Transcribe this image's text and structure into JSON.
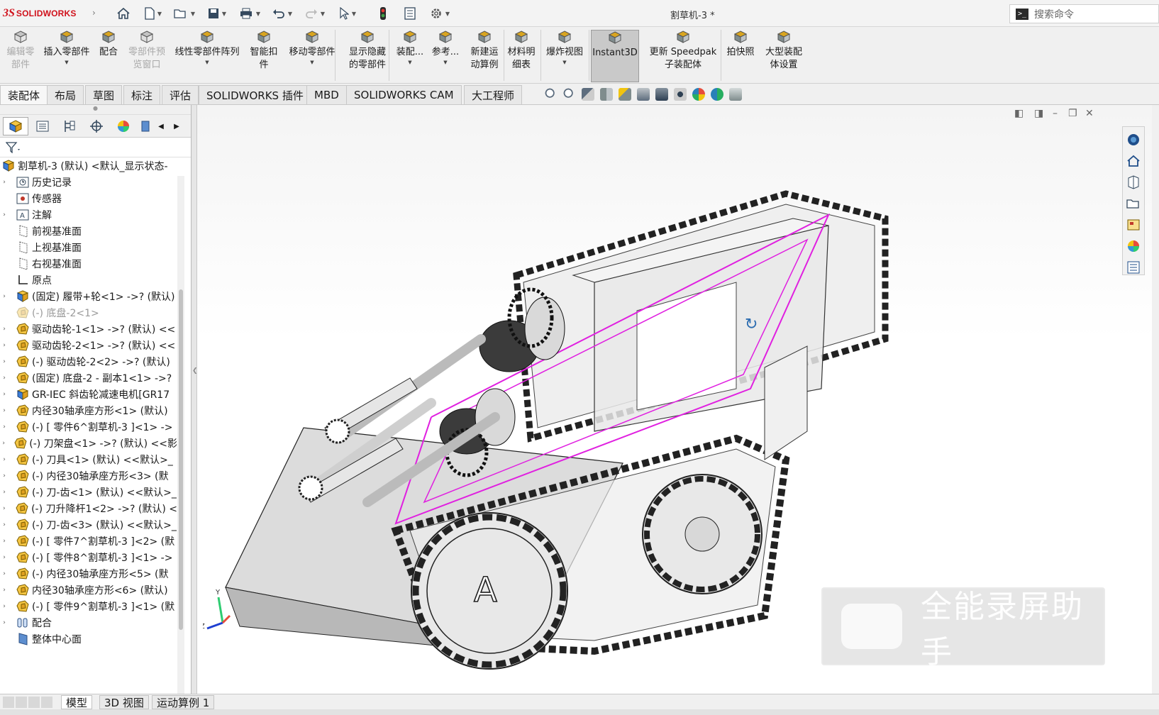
{
  "app": {
    "brand": "SOLIDWORKS",
    "document_title": "割草机-3 *"
  },
  "search": {
    "placeholder": "搜索命令"
  },
  "ribbon": {
    "buttons": [
      {
        "label": "编辑零\n部件",
        "disabled": true
      },
      {
        "label": "插入零部件"
      },
      {
        "label": "配合"
      },
      {
        "label": "零部件预\n览窗口",
        "disabled": true
      },
      {
        "label": "线性零部件阵列"
      },
      {
        "label": "智能扣\n件"
      },
      {
        "label": "移动零部件"
      },
      {
        "label": "显示隐藏\n的零部件"
      },
      {
        "label": "装配..."
      },
      {
        "label": "参考..."
      },
      {
        "label": "新建运\n动算例"
      },
      {
        "label": "材料明\n细表"
      },
      {
        "label": "爆炸视图"
      },
      {
        "label": "Instant3D",
        "active": true
      },
      {
        "label": "更新 Speedpak\n子装配体"
      },
      {
        "label": "拍快照"
      },
      {
        "label": "大型装配\n体设置"
      }
    ]
  },
  "tabs": [
    "装配体",
    "布局",
    "草图",
    "标注",
    "评估",
    "SOLIDWORKS 插件",
    "MBD",
    "SOLIDWORKS CAM",
    "大工程师"
  ],
  "active_tab": "装配体",
  "tree": {
    "root": "割草机-3 (默认) <默认_显示状态-",
    "items": [
      {
        "label": "历史记录",
        "icon": "history-icon",
        "exp": true
      },
      {
        "label": "传感器",
        "icon": "sensor-icon",
        "exp": false
      },
      {
        "label": "注解",
        "icon": "annotation-icon",
        "exp": true
      },
      {
        "label": "前视基准面",
        "icon": "plane-icon",
        "exp": false
      },
      {
        "label": "上视基准面",
        "icon": "plane-icon",
        "exp": false
      },
      {
        "label": "右视基准面",
        "icon": "plane-icon",
        "exp": false
      },
      {
        "label": "原点",
        "icon": "origin-icon",
        "exp": false
      },
      {
        "label": "(固定) 履带+轮<1> ->? (默认)",
        "icon": "subassembly-icon",
        "exp": true
      },
      {
        "label": "(-) 底盘-2<1>",
        "icon": "part-icon",
        "exp": false,
        "dim": true
      },
      {
        "label": "驱动齿轮-1<1> ->? (默认) <<",
        "icon": "part-icon",
        "exp": true
      },
      {
        "label": "驱动齿轮-2<1> ->? (默认) <<",
        "icon": "part-icon",
        "exp": true
      },
      {
        "label": "(-) 驱动齿轮-2<2> ->? (默认)",
        "icon": "part-icon",
        "exp": true
      },
      {
        "label": "(固定) 底盘-2 - 副本1<1> ->?",
        "icon": "part-icon",
        "exp": true
      },
      {
        "label": "GR-IEC 斜齿轮减速电机[GR17",
        "icon": "subassembly-icon",
        "exp": true
      },
      {
        "label": "内径30轴承座方形<1> (默认)",
        "icon": "part-icon",
        "exp": true
      },
      {
        "label": "(-) [ 零件6^割草机-3 ]<1> ->",
        "icon": "part-icon",
        "exp": true
      },
      {
        "label": "(-) 刀架盘<1> ->? (默认) <<影",
        "icon": "part-icon",
        "exp": true
      },
      {
        "label": "(-) 刀具<1> (默认) <<默认>_",
        "icon": "part-icon",
        "exp": true
      },
      {
        "label": "(-) 内径30轴承座方形<3> (默",
        "icon": "part-icon",
        "exp": true
      },
      {
        "label": "(-) 刀-齿<1> (默认) <<默认>_",
        "icon": "part-icon",
        "exp": true
      },
      {
        "label": "(-) 刀升降杆1<2> ->? (默认) <",
        "icon": "part-icon",
        "exp": true
      },
      {
        "label": "(-) 刀-齿<3> (默认) <<默认>_",
        "icon": "part-icon",
        "exp": true
      },
      {
        "label": "(-) [ 零件7^割草机-3 ]<2> (默",
        "icon": "part-icon",
        "exp": true
      },
      {
        "label": "(-) [ 零件8^割草机-3 ]<1> ->",
        "icon": "part-icon",
        "exp": true
      },
      {
        "label": "(-) 内径30轴承座方形<5> (默",
        "icon": "part-icon",
        "exp": true
      },
      {
        "label": "内径30轴承座方形<6> (默认)",
        "icon": "part-icon",
        "exp": true
      },
      {
        "label": "(-) [ 零件9^割草机-3 ]<1> (默",
        "icon": "part-icon",
        "exp": true
      },
      {
        "label": "配合",
        "icon": "mates-icon",
        "exp": true
      },
      {
        "label": "整体中心面",
        "icon": "plane-blue-icon",
        "exp": false
      }
    ]
  },
  "bottom_tabs": [
    "模型",
    "3D 视图",
    "运动算例 1"
  ],
  "active_bottom_tab": "模型",
  "watermark": {
    "text": "全能录屏助手"
  },
  "triad": {
    "y": "Y",
    "z": "Z"
  },
  "colors": {
    "brand": "#d0111b",
    "sketch": "#e020e0"
  }
}
